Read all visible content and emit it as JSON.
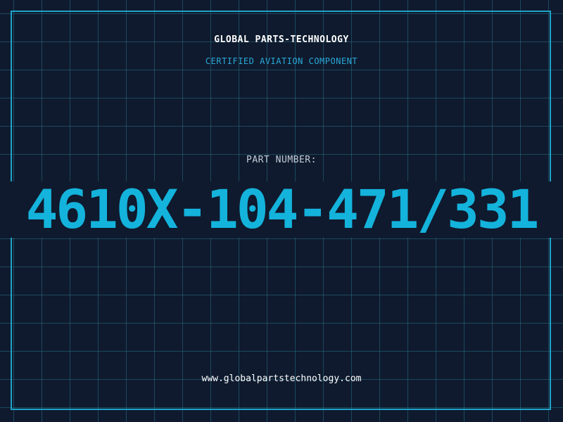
{
  "header": {
    "company_name": "GLOBAL PARTS-TECHNOLOGY",
    "subtitle": "CERTIFIED AVIATION COMPONENT"
  },
  "part": {
    "label": "PART NUMBER:",
    "number": "4610X-104-471/331"
  },
  "footer": {
    "website": "www.globalpartstechnology.com"
  },
  "colors": {
    "background": "#0f1a2e",
    "grid": "#286e82",
    "frame": "#1fa3c9",
    "accent": "#14b3dc",
    "subtitle": "#2aa8d8"
  }
}
